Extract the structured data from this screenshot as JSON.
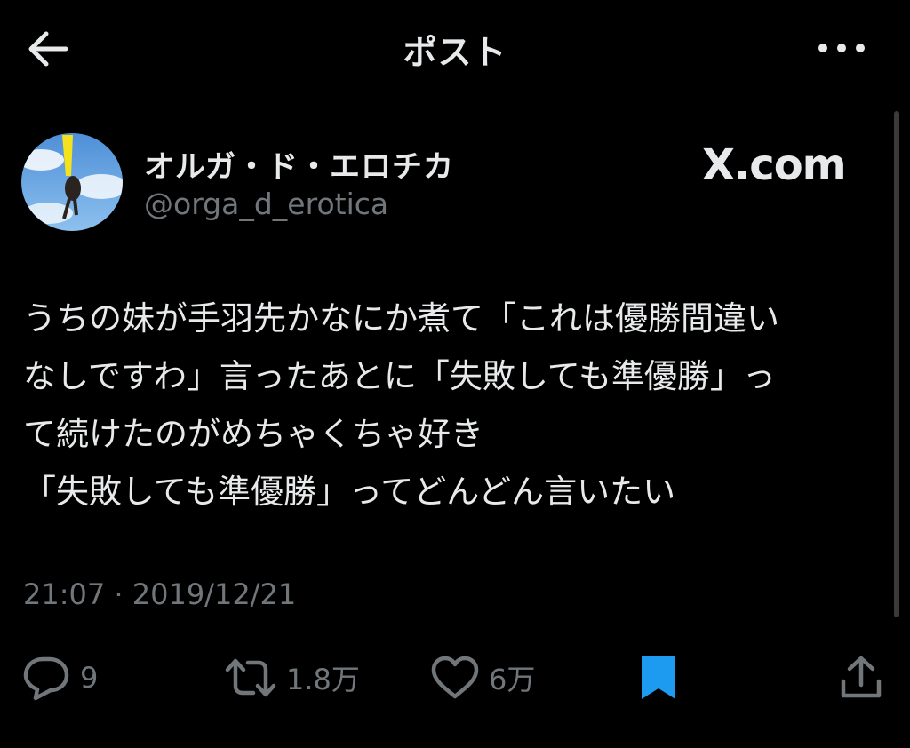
{
  "header": {
    "title": "ポスト",
    "back_icon": "arrow-left-icon",
    "more_icon": "more-dots-icon"
  },
  "author": {
    "display_name": "オルガ・ド・エロチカ",
    "handle": "@orga_d_erotica",
    "source": "X.com"
  },
  "tweet": {
    "lines": [
      "うちの妹が手羽先かなにか煮て「これは優勝間違い",
      "なしですわ」言ったあとに「失敗しても準優勝」っ",
      "て続けたのがめちゃくちゃ好き",
      "「失敗しても準優勝」ってどんどん言いたい"
    ],
    "timestamp": "21:07 · 2019/12/21"
  },
  "actions": {
    "reply": {
      "icon": "reply-bubble-icon",
      "count": "9"
    },
    "repost": {
      "icon": "repost-icon",
      "count": "1.8万"
    },
    "like": {
      "icon": "heart-icon",
      "count": "6万"
    },
    "bookmark": {
      "icon": "bookmark-icon",
      "active": true
    },
    "share": {
      "icon": "share-icon"
    }
  },
  "colors": {
    "background": "#000000",
    "text": "#e7e9ea",
    "muted": "#71767b",
    "bookmark_active": "#1d9bf0"
  }
}
